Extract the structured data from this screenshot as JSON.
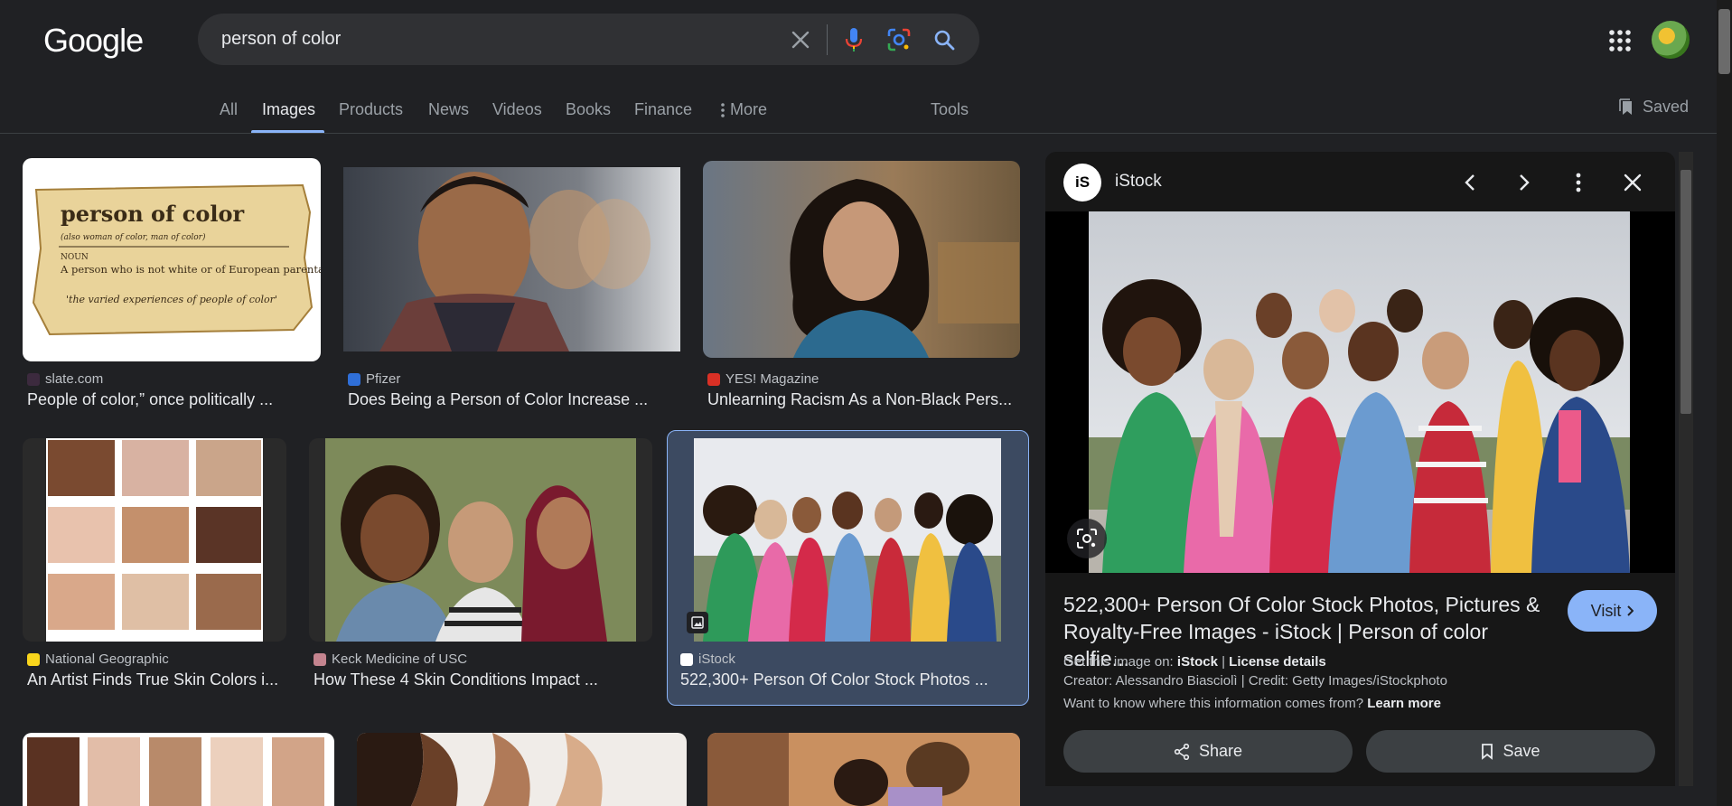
{
  "header": {
    "logo_text": "Google",
    "search_value": "person of color"
  },
  "nav": {
    "tabs": [
      {
        "label": "All"
      },
      {
        "label": "Images",
        "active": true
      },
      {
        "label": "Products"
      },
      {
        "label": "News"
      },
      {
        "label": "Videos"
      },
      {
        "label": "Books"
      },
      {
        "label": "Finance"
      },
      {
        "label": "More"
      }
    ],
    "tools_label": "Tools",
    "saved_label": "Saved"
  },
  "results": [
    {
      "source": "slate.com",
      "title": "People of color,” once politically ...",
      "favicon_color": "#3c2a3e"
    },
    {
      "source": "Pfizer",
      "title": "Does Being a Person of Color Increase ...",
      "favicon_color": "#2f6fd8"
    },
    {
      "source": "YES! Magazine",
      "title": "Unlearning Racism As a Non-Black Pers...",
      "favicon_color": "#d93025"
    },
    {
      "source": "National Geographic",
      "title": "An Artist Finds True Skin Colors i...",
      "favicon_color": "#f9d51c"
    },
    {
      "source": "Keck Medicine of USC",
      "title": "How These 4 Skin Conditions Impact ...",
      "favicon_color": "#c4848f"
    },
    {
      "source": "iStock",
      "title": "522,300+ Person Of Color Stock Photos ...",
      "favicon_color": "#ffffff"
    }
  ],
  "thumbnail_text": {
    "headword": "person of color",
    "subhead": "(also woman of color, man of color)",
    "pos": "NOUN",
    "definition": "A person who is not white or of European parentage.",
    "example": "'the varied experiences of people of color'"
  },
  "panel": {
    "source": "iStock",
    "logo_text": "iS",
    "title": "522,300+ Person Of Color Stock Photos, Pictures & Royalty-Free Images - iStock | Person of color selfie...",
    "visit_label": "Visit",
    "get_image_prefix": "Get this image on:",
    "get_image_source": "iStock",
    "separator": "|",
    "license_label": "License details",
    "creator_line": "Creator: Alessandro Biasciolì | Credit: Getty Images/iStockphoto",
    "info_prefix": "Want to know where this information comes from?",
    "learn_more": "Learn more",
    "share_label": "Share",
    "save_label": "Save"
  },
  "colors": {
    "accent": "#8ab4f8",
    "background": "#202124",
    "selected_card": "#3c4a61"
  }
}
